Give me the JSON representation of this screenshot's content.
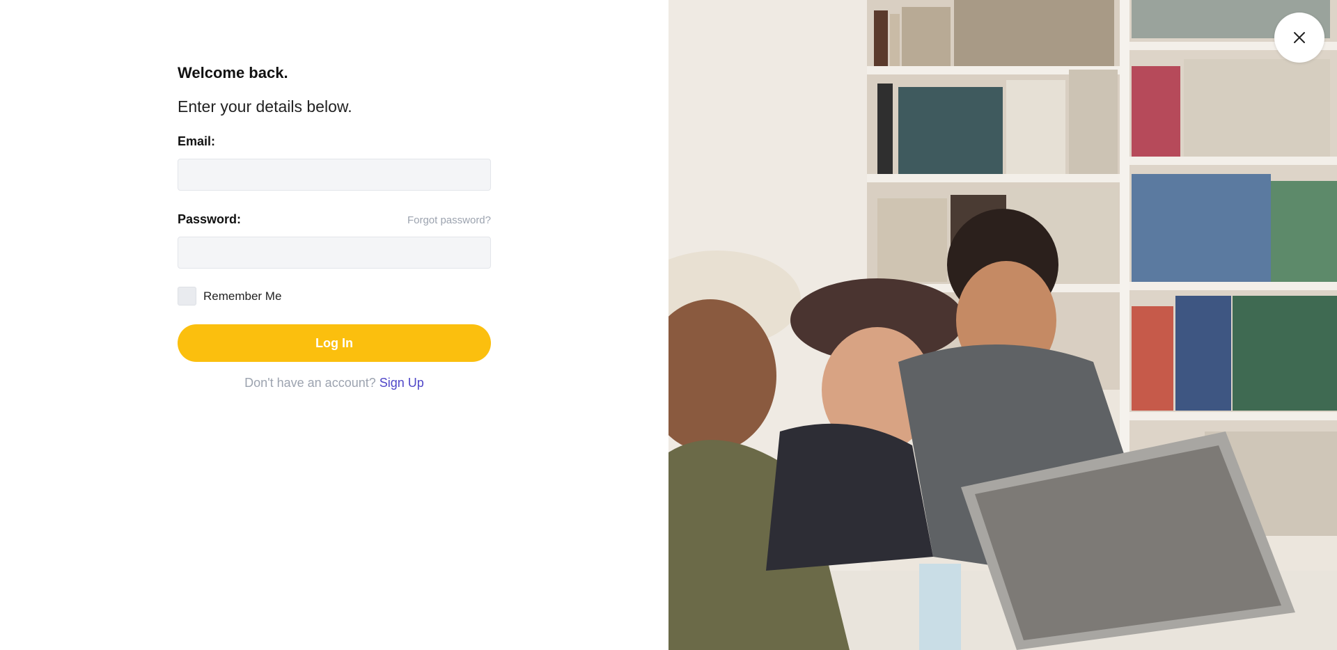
{
  "login": {
    "welcome": "Welcome back.",
    "subtitle": "Enter your details below.",
    "email_label": "Email:",
    "email_value": "",
    "email_placeholder": "",
    "password_label": "Password:",
    "password_value": "",
    "password_placeholder": "",
    "forgot_password": "Forgot password?",
    "remember_me": "Remember Me",
    "remember_checked": false,
    "login_button": "Log In",
    "signup_prompt": "Don't have an account?",
    "signup_link": "Sign Up"
  },
  "hero": {
    "image": "students-laughing-at-laptop-in-library-photo"
  },
  "icons": {
    "close": "close-icon"
  },
  "colors": {
    "accent": "#fbbf0e",
    "link": "#4f46c8",
    "muted_text": "#9ca3af",
    "input_bg": "#f4f5f7"
  }
}
